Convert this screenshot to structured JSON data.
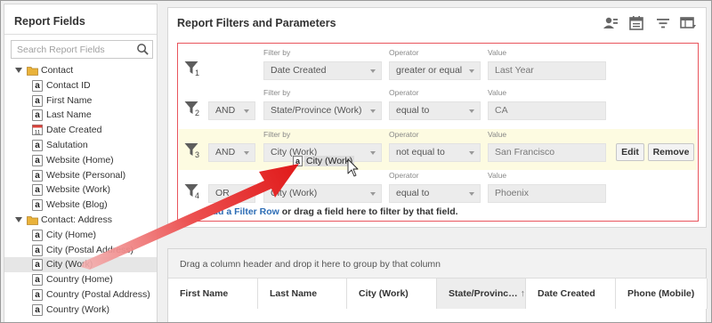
{
  "left_panel": {
    "title": "Report Fields",
    "search_placeholder": "Search Report Fields",
    "tree": [
      {
        "kind": "folder",
        "label": "Contact"
      },
      {
        "kind": "text",
        "label": "Contact ID"
      },
      {
        "kind": "text",
        "label": "First Name"
      },
      {
        "kind": "text",
        "label": "Last Name"
      },
      {
        "kind": "date",
        "label": "Date Created"
      },
      {
        "kind": "text",
        "label": "Salutation"
      },
      {
        "kind": "text",
        "label": "Website (Home)"
      },
      {
        "kind": "text",
        "label": "Website (Personal)"
      },
      {
        "kind": "text",
        "label": "Website (Work)"
      },
      {
        "kind": "text",
        "label": "Website (Blog)"
      },
      {
        "kind": "folder",
        "label": "Contact: Address"
      },
      {
        "kind": "text",
        "label": "City (Home)"
      },
      {
        "kind": "text",
        "label": "City (Postal Address)"
      },
      {
        "kind": "text",
        "label": "City (Work)",
        "selected": true
      },
      {
        "kind": "text",
        "label": "Country (Home)"
      },
      {
        "kind": "text",
        "label": "Country (Postal Address)"
      },
      {
        "kind": "text",
        "label": "Country (Work)"
      }
    ]
  },
  "filters_panel": {
    "title": "Report Filters and Parameters",
    "toolbar_icons": [
      "person-card-icon",
      "calendar-icon",
      "filter-lines-icon",
      "table-settings-icon"
    ],
    "labels": {
      "filter_by": "Filter by",
      "operator": "Operator",
      "value": "Value"
    },
    "rows": [
      {
        "num": "1",
        "conj": "",
        "field": "Date Created",
        "operator": "greater or equal",
        "value": "Last Year"
      },
      {
        "num": "2",
        "conj": "AND",
        "field": "State/Province (Work)",
        "operator": "equal to",
        "value": "CA"
      },
      {
        "num": "3",
        "conj": "AND",
        "field": "City (Work)",
        "operator": "not equal to",
        "value": "San Francisco",
        "highlight": true,
        "edit": "Edit",
        "remove": "Remove"
      },
      {
        "num": "4",
        "conj": "OR",
        "field": "City (Work)",
        "operator": "equal to",
        "value": "Phoenix"
      }
    ],
    "add_row_link": "Add a Filter Row",
    "add_row_rest": " or drag a field here to filter by that field.",
    "drag_ghost": "City (Work)"
  },
  "grid": {
    "group_hint": "Drag a column header and drop it here to group by that column",
    "columns": [
      {
        "label": "First Name"
      },
      {
        "label": "Last Name"
      },
      {
        "label": "City (Work)"
      },
      {
        "label": "State/Provinc…",
        "sorted": true,
        "sort_glyph": "↑"
      },
      {
        "label": "Date Created"
      },
      {
        "label": "Phone (Mobile)"
      }
    ]
  },
  "colors": {
    "accent_red": "#e8545c",
    "link_blue": "#2c6cb5",
    "highlight_row": "#fdfbe1",
    "folder": "#e9b23a"
  }
}
